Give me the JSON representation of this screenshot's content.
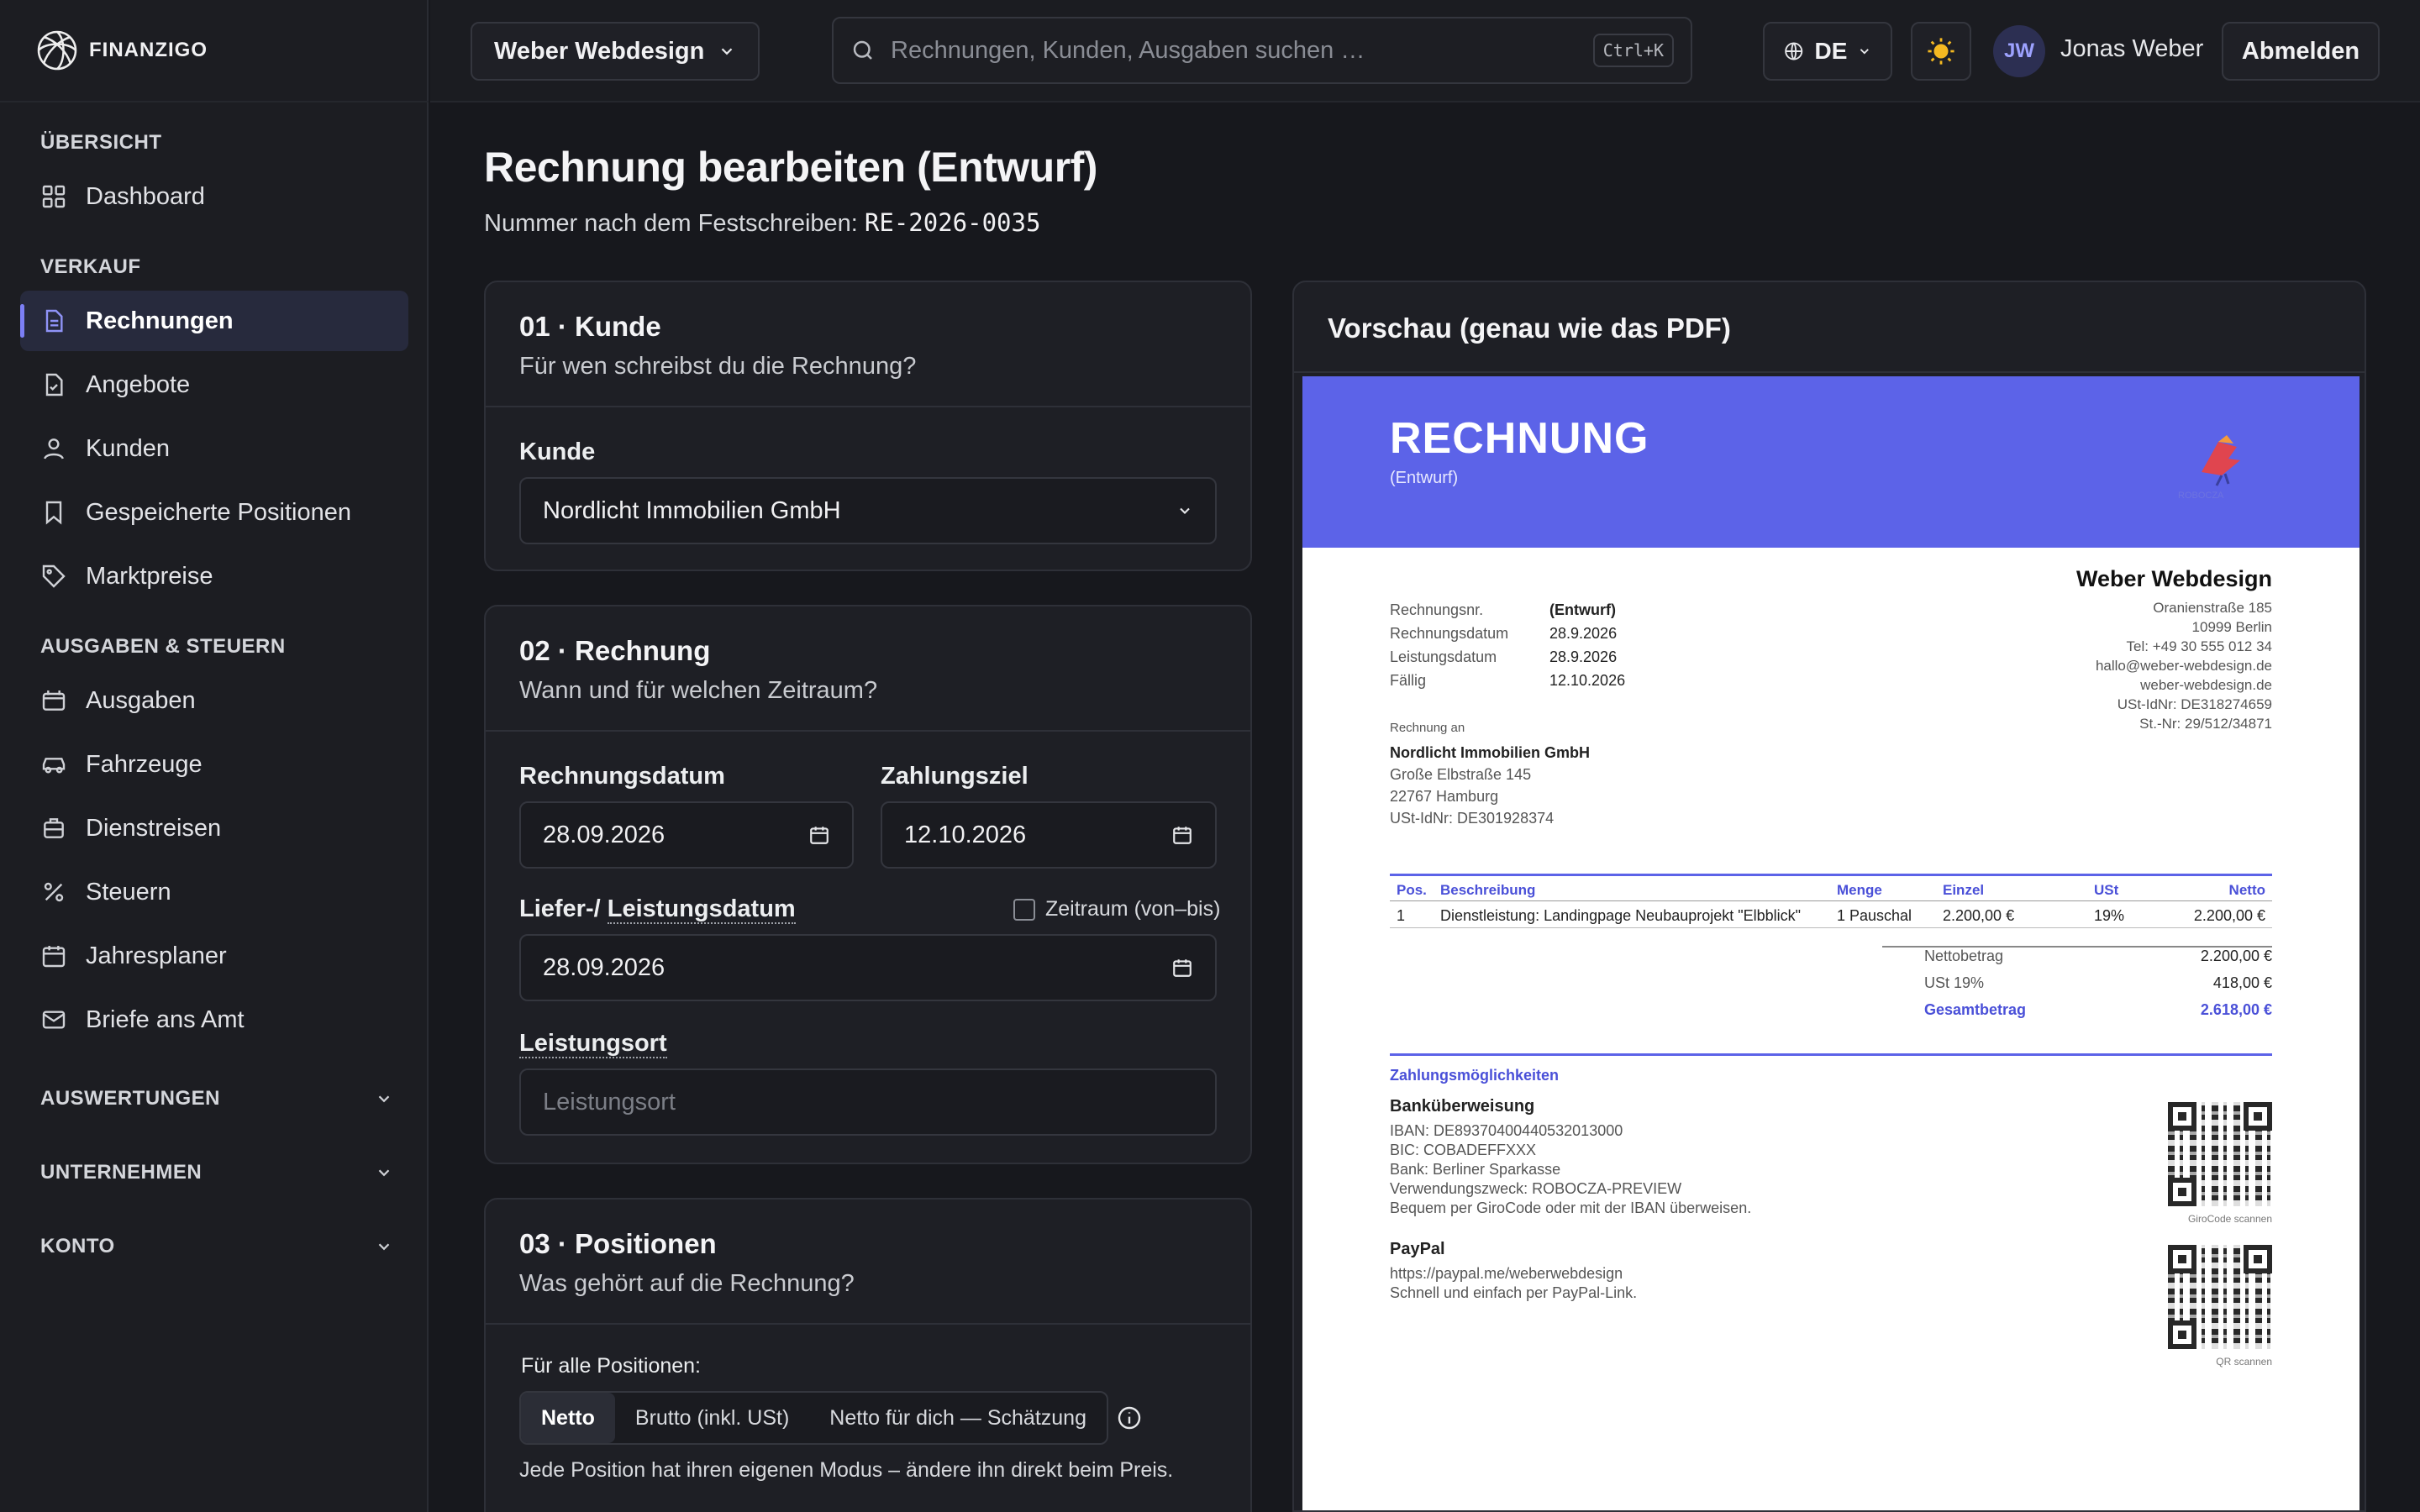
{
  "app": {
    "logo_text": "FINANZIGO"
  },
  "sidebar": {
    "sections": [
      {
        "title": "ÜBERSICHT",
        "items": [
          {
            "label": "Dashboard",
            "icon": "grid-icon"
          }
        ]
      },
      {
        "title": "VERKAUF",
        "items": [
          {
            "label": "Rechnungen",
            "icon": "document-icon",
            "active": true
          },
          {
            "label": "Angebote",
            "icon": "document-check-icon"
          },
          {
            "label": "Kunden",
            "icon": "user-icon"
          },
          {
            "label": "Gespeicherte Positionen",
            "icon": "bookmark-icon"
          },
          {
            "label": "Marktpreise",
            "icon": "tag-icon"
          }
        ]
      },
      {
        "title": "AUSGABEN & STEUERN",
        "items": [
          {
            "label": "Ausgaben",
            "icon": "wallet-icon"
          },
          {
            "label": "Fahrzeuge",
            "icon": "car-icon"
          },
          {
            "label": "Dienstreisen",
            "icon": "briefcase-icon"
          },
          {
            "label": "Steuern",
            "icon": "percent-icon"
          },
          {
            "label": "Jahresplaner",
            "icon": "calendar-icon"
          },
          {
            "label": "Briefe ans Amt",
            "icon": "mail-icon"
          }
        ]
      }
    ],
    "collapsibles": [
      "AUSWERTUNGEN",
      "UNTERNEHMEN",
      "KONTO"
    ]
  },
  "topbar": {
    "company": "Weber Webdesign",
    "search_placeholder": "Rechnungen, Kunden, Ausgaben suchen …",
    "search_shortcut": "Ctrl+K",
    "language": "DE",
    "user_initials": "JW",
    "user_name": "Jonas Weber",
    "logout": "Abmelden"
  },
  "page": {
    "title": "Rechnung bearbeiten (Entwurf)",
    "number_label": "Nummer nach dem Festschreiben:",
    "number_value": "RE-2026-0035"
  },
  "card_customer": {
    "title": "01 · Kunde",
    "subtitle": "Für wen schreibst du die Rechnung?",
    "field_label": "Kunde",
    "value": "Nordlicht Immobilien GmbH"
  },
  "card_invoice": {
    "title": "02 · Rechnung",
    "subtitle": "Wann und für welchen Zeitraum?",
    "date_label": "Rechnungsdatum",
    "date_value": "28.09.2026",
    "due_label": "Zahlungsziel",
    "due_value": "12.10.2026",
    "service_label_a": "Liefer-/",
    "service_label_b": "Leistungsdatum",
    "range_label": "Zeitraum (von–bis)",
    "service_value": "28.09.2026",
    "place_label": "Leistungsort",
    "place_placeholder": "Leistungsort"
  },
  "card_positions": {
    "title": "03 · Positionen",
    "subtitle": "Was gehört auf die Rechnung?",
    "for_all": "Für alle Positionen:",
    "modes": [
      "Netto",
      "Brutto (inkl. USt)",
      "Netto für dich — Schätzung"
    ],
    "hint": "Jede Position hat ihren eigenen Modus – ändere ihn direkt beim Preis."
  },
  "preview": {
    "title": "Vorschau (genau wie das PDF)",
    "doc_title": "RECHNUNG",
    "doc_sub": "(Entwurf)",
    "logo_caption": "ROBOCZA",
    "meta": [
      {
        "k": "Rechnungsnr.",
        "v": "(Entwurf)"
      },
      {
        "k": "Rechnungsdatum",
        "v": "28.9.2026"
      },
      {
        "k": "Leistungsdatum",
        "v": "28.9.2026"
      },
      {
        "k": "Fällig",
        "v": "12.10.2026"
      }
    ],
    "seller": {
      "name": "Weber Webdesign",
      "lines": [
        "Oranienstraße 185",
        "10999 Berlin",
        "Tel: +49 30 555 012 34",
        "hallo@weber-webdesign.de",
        "weber-webdesign.de",
        "USt-IdNr: DE318274659",
        "St.-Nr: 29/512/34871"
      ]
    },
    "bill_to_label": "Rechnung an",
    "buyer": {
      "name": "Nordlicht Immobilien GmbH",
      "lines": [
        "Große Elbstraße 145",
        "22767 Hamburg",
        "USt-IdNr: DE301928374"
      ]
    },
    "table_headers": [
      "Pos.",
      "Beschreibung",
      "Menge",
      "Einzel",
      "USt",
      "Netto"
    ],
    "rows": [
      [
        "1",
        "Dienstleistung: Landingpage Neubauprojekt \"Elbblick\"",
        "1 Pauschal",
        "2.200,00 €",
        "19%",
        "2.200,00 €"
      ]
    ],
    "totals": [
      {
        "k": "Nettobetrag",
        "v": "2.200,00 €"
      },
      {
        "k": "USt 19%",
        "v": "418,00 €"
      },
      {
        "k": "Gesamtbetrag",
        "v": "2.618,00 €"
      }
    ],
    "payment_title": "Zahlungsmöglichkeiten",
    "bank_title": "Banküberweisung",
    "bank_lines": [
      "IBAN: DE89370400440532013000",
      "BIC: COBADEFFXXX",
      "Bank: Berliner Sparkasse",
      "Verwendungszweck: ROBOCZA-PREVIEW",
      "Bequem per GiroCode oder mit der IBAN überweisen."
    ],
    "giro_caption": "GiroCode scannen",
    "paypal_title": "PayPal",
    "paypal_lines": [
      "https://paypal.me/weberwebdesign",
      "Schnell und einfach per PayPal-Link."
    ],
    "qr_caption": "QR scannen"
  },
  "colors": {
    "accent": "#5c63e8",
    "active_bg": "#272a3d",
    "bg": "#17181d"
  }
}
